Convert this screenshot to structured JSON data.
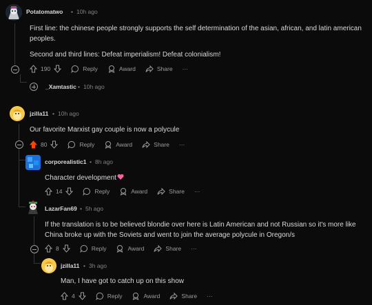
{
  "comments": [
    {
      "username": "Potatomatwo",
      "time": "10h ago",
      "body": [
        "First line: the chinese people strongly supports the self determination of the asian, african, and latin american peoples.",
        "Second and third lines: Defeat imperialism! Defeat colonialism!"
      ],
      "votes": "190",
      "upvoted": false,
      "reply_label": "Reply",
      "award_label": "Award",
      "share_label": "Share",
      "more_label": "···"
    },
    {
      "username": "_Xamtastic",
      "time": "10h ago",
      "collapsed": true
    },
    {
      "username": "jzilla11",
      "time": "10h ago",
      "body": [
        "Our favorite Marxist gay couple is now a polycule"
      ],
      "votes": "80",
      "upvoted": true,
      "reply_label": "Reply",
      "award_label": "Award",
      "share_label": "Share",
      "more_label": "···"
    },
    {
      "username": "corporealistic1",
      "time": "8h ago",
      "body": [
        "Character development"
      ],
      "emoji": "pink-heart",
      "votes": "14",
      "reply_label": "Reply",
      "award_label": "Award",
      "share_label": "Share",
      "more_label": "···"
    },
    {
      "username": "LazarFan69",
      "time": "5h ago",
      "body": [
        "If the translation is to be believed blondie over here is Latin American and not Russian so it's more like China broke up with the Soviets and went to join the average polycule in Oregon/s"
      ],
      "votes": "8",
      "reply_label": "Reply",
      "award_label": "Award",
      "share_label": "Share",
      "more_label": "···"
    },
    {
      "username": "jzilla11",
      "time": "3h ago",
      "body": [
        "Man, I have got to catch up on this show"
      ],
      "votes": "4",
      "reply_label": "Reply",
      "award_label": "Award",
      "share_label": "Share",
      "more_label": "···"
    }
  ],
  "colors": {
    "background": "#0b0b0c",
    "upvote_active": "#ff4500",
    "heart": "#ff5fa2"
  }
}
